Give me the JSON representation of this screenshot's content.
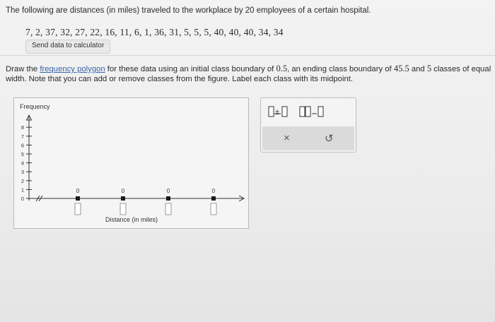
{
  "intro": "The following are distances (in miles) traveled to the workplace by 20 employees of a certain hospital.",
  "data_list": "7, 2, 37, 32, 27, 22, 16, 11, 6, 1, 36, 31, 5, 5, 5, 40, 40, 40, 34, 34",
  "send_button": "Send data to calculator",
  "instructions": {
    "part1": "Draw the ",
    "link": "frequency polygon",
    "part2": " for these data using an initial class boundary of ",
    "v1": "0.5",
    "part3": ", an ending class boundary of ",
    "v2": "45.5",
    "part4": " and ",
    "v3": "5",
    "part5": " classes of equal width. Note that you can add or remove classes from the figure. Label each class with its midpoint."
  },
  "graph": {
    "y_label": "Frequency",
    "x_label": "Distance (in miles)",
    "y_ticks": [
      "0",
      "1",
      "2",
      "3",
      "4",
      "5",
      "6",
      "7",
      "8"
    ],
    "point_values": [
      "0",
      "0",
      "0",
      "0"
    ],
    "point_label_boxes": [
      "",
      "",
      "",
      ""
    ]
  },
  "tools": {
    "x_symbol": "×",
    "undo_symbol": "↺"
  },
  "colors": {
    "point": "#1a1a1a",
    "link": "#3a64a8",
    "panel_border": "#b9b9b9"
  }
}
